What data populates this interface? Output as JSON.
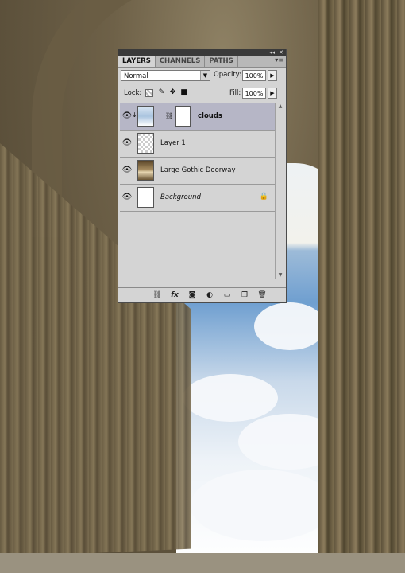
{
  "panel": {
    "tabs": [
      {
        "label": "LAYERS",
        "active": true
      },
      {
        "label": "CHANNELS",
        "active": false
      },
      {
        "label": "PATHS",
        "active": false
      }
    ],
    "blend_mode": "Normal",
    "opacity_label": "Opacity:",
    "opacity_value": "100%",
    "lock_label": "Lock:",
    "fill_label": "Fill:",
    "fill_value": "100%"
  },
  "layers": [
    {
      "name": "clouds",
      "visible": true,
      "selected": true,
      "thumbnail": "clouds",
      "has_mask": true
    },
    {
      "name": "Layer 1",
      "visible": true,
      "selected": false,
      "thumbnail": "checker"
    },
    {
      "name": "Large Gothic Doorway",
      "visible": true,
      "selected": false,
      "thumbnail": "photo"
    },
    {
      "name": "Background",
      "visible": true,
      "selected": false,
      "thumbnail": "white",
      "locked": true
    }
  ],
  "bottom_icons": [
    "link-icon",
    "fx-icon",
    "mask-icon",
    "adjustment-icon",
    "group-folder-icon",
    "new-layer-icon",
    "trash-icon"
  ],
  "colors": {
    "panel_bg": "#d4d4d4",
    "selected_row": "#b6b6c6",
    "titlebar": "#3a3a3a"
  }
}
